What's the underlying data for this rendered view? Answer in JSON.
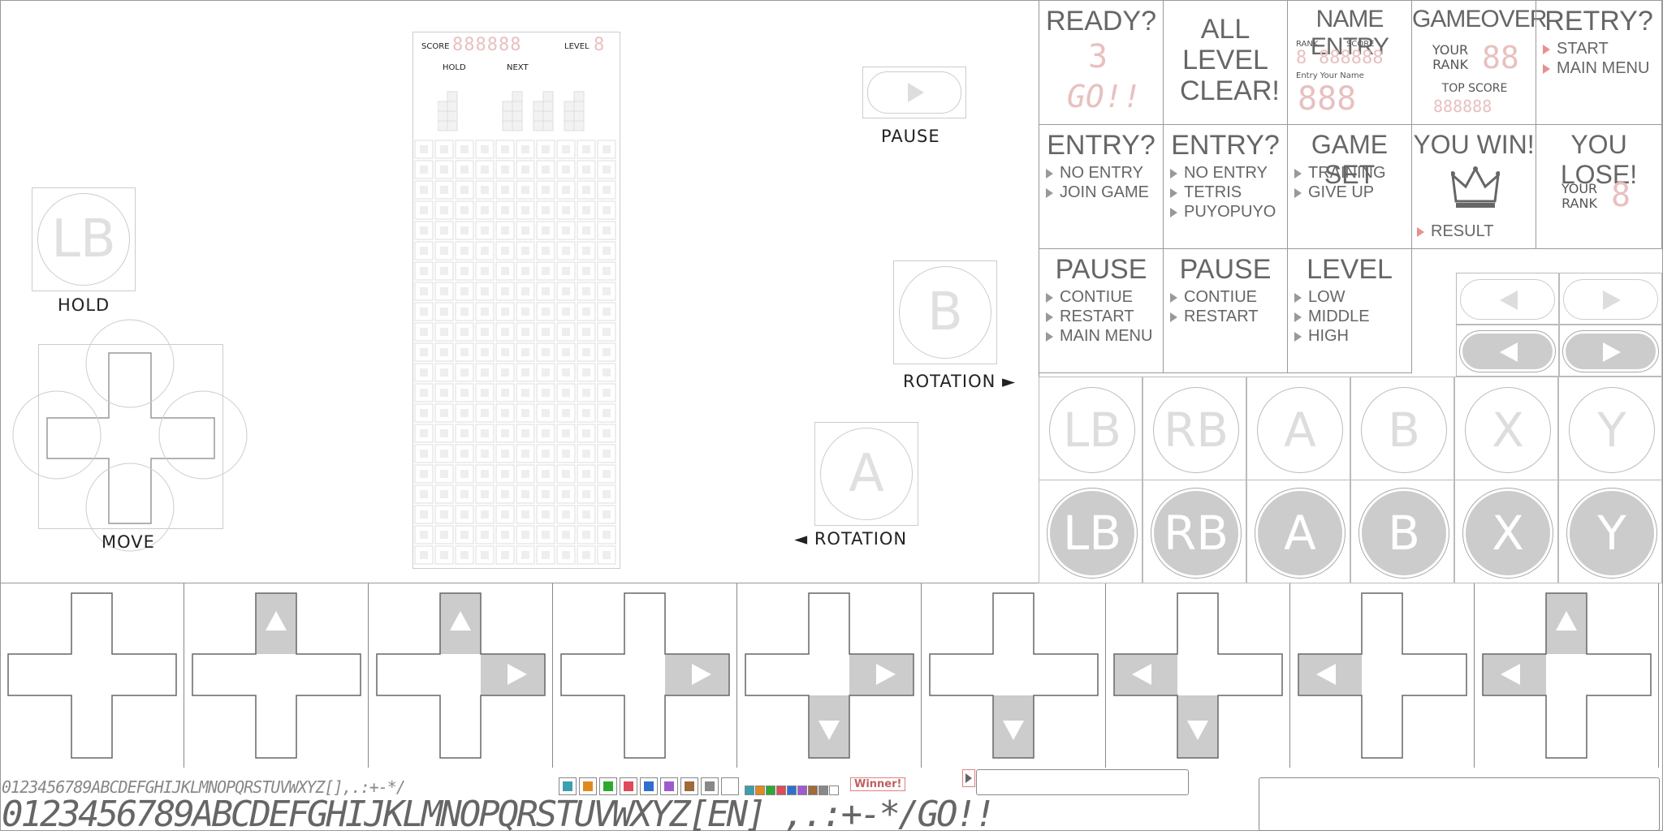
{
  "left": {
    "hold_button_letter": "LB",
    "hold_label": "HOLD",
    "move_label": "MOVE",
    "pause_label": "PAUSE",
    "b_letter": "B",
    "rotation_right_label": "ROTATION ►",
    "a_letter": "A",
    "rotation_left_label": "◄ ROTATION"
  },
  "board": {
    "score_label": "SCORE",
    "score_digits": "888888",
    "level_label": "LEVEL",
    "level_digit": "8",
    "hold_label": "HOLD",
    "next_label": "NEXT"
  },
  "panels": {
    "ready": {
      "title": "READY?",
      "count": "3",
      "go": "GO!!"
    },
    "clear": {
      "title": "ALL LEVEL CLEAR!"
    },
    "name_entry": {
      "title": "NAME ENTRY",
      "rank_label": "RANK",
      "score_label": "SCORE",
      "rank_digit": "8",
      "score_digits": "888888",
      "entry_label": "Entry Your Name",
      "name_digits": "888"
    },
    "gameover": {
      "title": "GAMEOVER",
      "your_rank": "YOUR RANK",
      "rank_digits": "88",
      "top_score": "TOP SCORE",
      "top_digits": "888888"
    },
    "retry": {
      "title": "RETRY?",
      "options": [
        "START",
        "MAIN MENU"
      ]
    },
    "entry1": {
      "title": "ENTRY?",
      "options": [
        "NO ENTRY",
        "JOIN GAME"
      ]
    },
    "entry2": {
      "title": "ENTRY?",
      "options": [
        "NO ENTRY",
        "TETRIS",
        "PUYOPUYO"
      ]
    },
    "gameset": {
      "title": "GAME SET",
      "options": [
        "TRAINING",
        "GIVE UP"
      ]
    },
    "youwin": {
      "title": "YOU WIN!",
      "result": "RESULT"
    },
    "youlose": {
      "title": "YOU LOSE!",
      "your_rank": "YOUR RANK",
      "rank_digit": "8"
    },
    "pause1": {
      "title": "PAUSE",
      "options": [
        "CONTIUE",
        "RESTART",
        "MAIN MENU"
      ]
    },
    "pause2": {
      "title": "PAUSE",
      "options": [
        "CONTIUE",
        "RESTART"
      ]
    },
    "level": {
      "title": "LEVEL",
      "options": [
        "LOW",
        "MIDDLE",
        "HIGH"
      ]
    }
  },
  "buttons": [
    "LB",
    "RB",
    "A",
    "B",
    "X",
    "Y"
  ],
  "font_strip": {
    "small": "0123456789ABCDEFGHIJKLMNOPQRSTUVWXYZ[],.:+-*/",
    "large": "0123456789ABCDEFGHIJKLMNOPQRSTUVWXYZ[EN] ,.:+-*/GO!!",
    "winner": "Winner!",
    "colors": [
      "#3aa0b0",
      "#e08a1e",
      "#2fa82f",
      "#e04a5a",
      "#2f6fd0",
      "#a05ad0",
      "#a06a3a",
      "#888888",
      "#ffffff"
    ]
  }
}
